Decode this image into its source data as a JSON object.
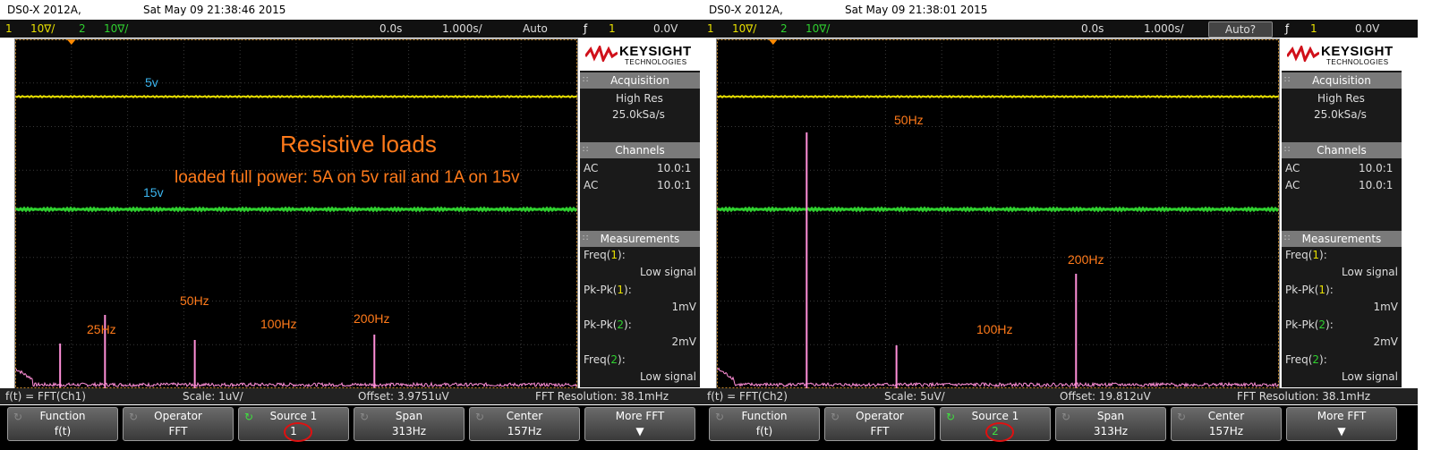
{
  "scopes": [
    {
      "model": "DS0-X 2012A,",
      "date": "Sat May 09 21:38:46 2015",
      "status": {
        "ch1_num": "1",
        "ch1_scale": "10∇/",
        "ch2_num": "2",
        "ch2_scale": "10∇/",
        "time_offset": "0.0s",
        "time_scale": "1.000s/",
        "trigger_mode": "Auto",
        "trig_icon": "ƒ",
        "trig_ch": "1",
        "trig_level": "0.0V"
      },
      "annotations": {
        "label_5v": "5v",
        "label_15v": "15v",
        "title": "Resistive loads",
        "subtitle": "loaded full power: 5A on 5v rail and 1A on 15v",
        "peak_labels": [
          "25Hz",
          "50Hz",
          "100Hz",
          "200Hz"
        ]
      },
      "panel": {
        "brand": "KEYSIGHT",
        "brand_sub": "TECHNOLOGIES",
        "acq_head": "Acquisition",
        "acq_mode": "High Res",
        "acq_rate": "25.0kSa/s",
        "ch_head": "Channels",
        "ch_rows": [
          {
            "coupling": "AC",
            "probe": "10.0:1"
          },
          {
            "coupling": "AC",
            "probe": "10.0:1"
          }
        ],
        "meas_head": "Measurements",
        "meas": [
          {
            "name": "Freq(",
            "ch": "1",
            "close": "):",
            "value": "Low signal"
          },
          {
            "name": "Pk-Pk(",
            "ch": "1",
            "close": "):",
            "value": "1mV"
          },
          {
            "name": "Pk-Pk(",
            "ch": "2",
            "close": "):",
            "value": "2mV"
          },
          {
            "name": "Freq(",
            "ch": "2",
            "close": "):",
            "value": "Low signal"
          }
        ]
      },
      "bottom": {
        "func": "f(t) = FFT(Ch1)",
        "scale": "Scale: 1uV/",
        "offset": "Offset: 3.9751uV",
        "res": "FFT Resolution: 38.1mHz"
      },
      "softkeys": [
        {
          "l1": "Function",
          "l2": "f(t)"
        },
        {
          "l1": "Operator",
          "l2": "FFT"
        },
        {
          "l1": "Source 1",
          "l2": "1"
        },
        {
          "l1": "Span",
          "l2": "313Hz"
        },
        {
          "l1": "Center",
          "l2": "157Hz"
        },
        {
          "l1": "More FFT",
          "l2": ""
        }
      ],
      "fft_peaks_hz": [
        25,
        50,
        100,
        200
      ]
    },
    {
      "model": "DS0-X 2012A,",
      "date": "Sat May 09 21:38:01 2015",
      "status": {
        "ch1_num": "1",
        "ch1_scale": "10∇/",
        "ch2_num": "2",
        "ch2_scale": "10∇/",
        "time_offset": "0.0s",
        "time_scale": "1.000s/",
        "trigger_mode": "Auto?",
        "trig_icon": "ƒ",
        "trig_ch": "1",
        "trig_level": "0.0V"
      },
      "annotations": {
        "peak_labels": [
          "50Hz",
          "200Hz",
          "100Hz"
        ]
      },
      "panel": {
        "brand": "KEYSIGHT",
        "brand_sub": "TECHNOLOGIES",
        "acq_head": "Acquisition",
        "acq_mode": "High Res",
        "acq_rate": "25.0kSa/s",
        "ch_head": "Channels",
        "ch_rows": [
          {
            "coupling": "AC",
            "probe": "10.0:1"
          },
          {
            "coupling": "AC",
            "probe": "10.0:1"
          }
        ],
        "meas_head": "Measurements",
        "meas": [
          {
            "name": "Freq(",
            "ch": "1",
            "close": "):",
            "value": "Low signal"
          },
          {
            "name": "Pk-Pk(",
            "ch": "1",
            "close": "):",
            "value": "1mV"
          },
          {
            "name": "Pk-Pk(",
            "ch": "2",
            "close": "):",
            "value": "2mV"
          },
          {
            "name": "Freq(",
            "ch": "2",
            "close": "):",
            "value": "Low signal"
          }
        ]
      },
      "bottom": {
        "func": "f(t) = FFT(Ch2)",
        "scale": "Scale: 5uV/",
        "offset": "Offset: 19.812uV",
        "res": "FFT Resolution: 38.1mHz"
      },
      "softkeys": [
        {
          "l1": "Function",
          "l2": "f(t)"
        },
        {
          "l1": "Operator",
          "l2": "FFT"
        },
        {
          "l1": "Source 1",
          "l2": "2"
        },
        {
          "l1": "Span",
          "l2": "313Hz"
        },
        {
          "l1": "Center",
          "l2": "157Hz"
        },
        {
          "l1": "More FFT",
          "l2": ""
        }
      ],
      "fft_peaks_hz": [
        50,
        100,
        200
      ]
    }
  ],
  "colors": {
    "ch1": "#e8e000",
    "ch2": "#2fd02f",
    "math": "#ff8fd8",
    "annotation": "#ff7a1a",
    "label_blue": "#3bb6f0"
  }
}
